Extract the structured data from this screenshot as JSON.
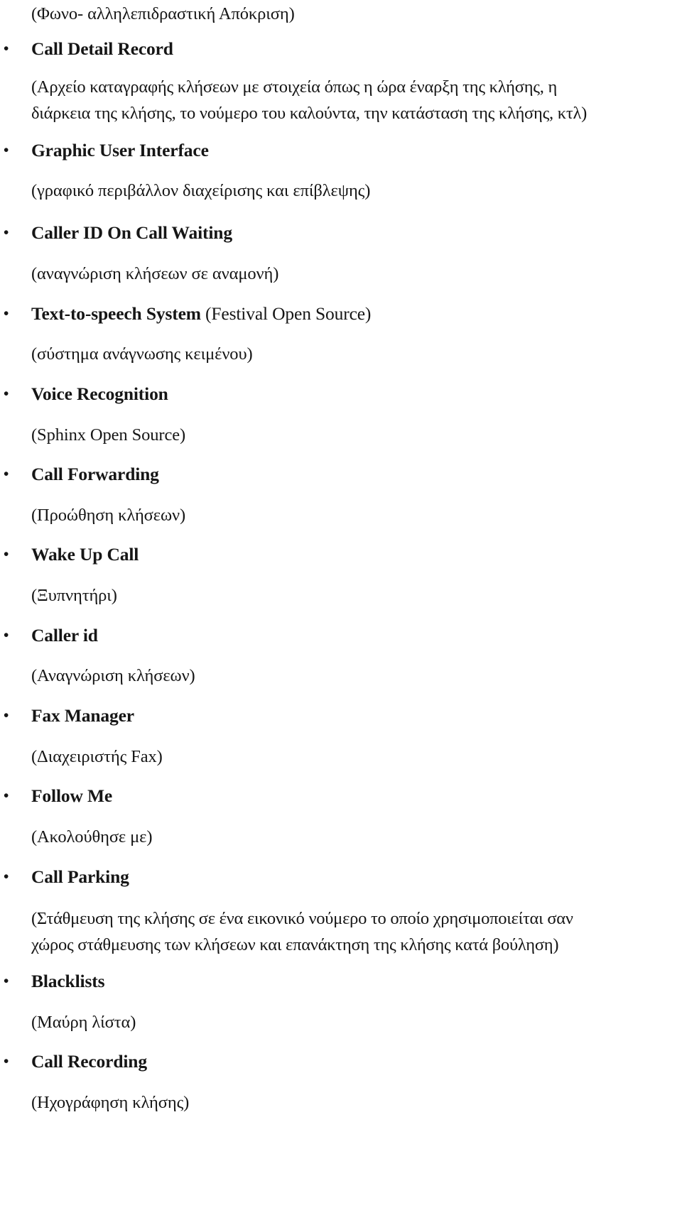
{
  "document": {
    "language_note": "Greek-English bilingual telephony feature list",
    "intro_translation": "(Φωνο- αλληλεπιδραστική Απόκριση)"
  },
  "features": [
    {
      "name": "Call Detail Record",
      "suffix": "",
      "translation_lines": [
        "(Αρχείο καταγραφής κλήσεων με στοιχεία όπως η ώρα έναρξη της κλήσης, η",
        "διάρκεια της κλήσης, το νούμερο του καλούντα, την κατάσταση της κλήσης, κτλ)"
      ]
    },
    {
      "name": "Graphic User Interface",
      "suffix": "",
      "translation_lines": [
        "(γραφικό περιβάλλον διαχείρισης και επίβλεψης)"
      ]
    },
    {
      "name": "Caller ID On Call Waiting",
      "suffix": "",
      "translation_lines": [
        "(αναγνώριση κλήσεων σε αναμονή)"
      ]
    },
    {
      "name": "Text-to-speech System",
      "suffix": " (Festival Open  Source)",
      "translation_lines": [
        "(σύστημα ανάγνωσης κειμένου)"
      ]
    },
    {
      "name": "Voice Recognition",
      "suffix": "",
      "translation_lines": [
        "(Sphinx Open Source)"
      ]
    },
    {
      "name": "Call Forwarding",
      "suffix": "",
      "translation_lines": [
        "(Προώθηση κλήσεων)"
      ]
    },
    {
      "name": "Wake Up Call",
      "suffix": "",
      "translation_lines": [
        "(Ξυπνητήρι)"
      ]
    },
    {
      "name": "Caller id",
      "suffix": "",
      "translation_lines": [
        "(Αναγνώριση κλήσεων)"
      ]
    },
    {
      "name": "Fax Manager",
      "suffix": "",
      "translation_lines": [
        "(Διαχειριστής Fax)"
      ]
    },
    {
      "name": "Follow Me",
      "suffix": "",
      "translation_lines": [
        "(Ακολούθησε με)"
      ]
    },
    {
      "name": "Call Parking",
      "suffix": "",
      "translation_lines": [
        "(Στάθμευση της κλήσης σε ένα εικονικό νούμερο το οποίο χρησιμοποιείται σαν",
        "χώρος στάθμευσης των κλήσεων και επανάκτηση της κλήσης κατά βούληση)"
      ]
    },
    {
      "name": "Blacklists",
      "suffix": "",
      "translation_lines": [
        "(Μαύρη λίστα)"
      ]
    },
    {
      "name": "Call Recording",
      "suffix": "",
      "translation_lines": [
        "(Ηχογράφηση κλήσης)"
      ]
    }
  ],
  "colors": {
    "text": "#161616",
    "background": "#ffffff"
  }
}
